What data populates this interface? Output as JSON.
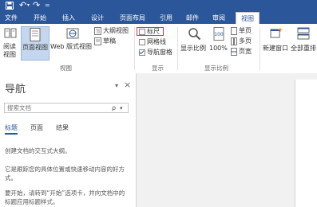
{
  "quick_access": {
    "save_icon": "save-icon",
    "undo_icon": "undo-icon",
    "undo_arrow": "↶",
    "redo_icon": "redo-icon",
    "redo_glyph": "↷",
    "customize_glyph": "="
  },
  "tabs": [
    {
      "label": "文件",
      "active": false
    },
    {
      "label": "开始",
      "active": false
    },
    {
      "label": "插入",
      "active": false
    },
    {
      "label": "设计",
      "active": false
    },
    {
      "label": "页面布局",
      "active": false
    },
    {
      "label": "引用",
      "active": false
    },
    {
      "label": "邮件",
      "active": false
    },
    {
      "label": "审阅",
      "active": false
    },
    {
      "label": "视图",
      "active": true
    }
  ],
  "ribbon": {
    "views": {
      "group_label": "视图",
      "read_mode": "阅读",
      "read_mode_2": "视图",
      "print_layout": "页面视图",
      "web_layout": "Web 版式视图",
      "outline": "大纲视图",
      "draft": "草稿"
    },
    "show": {
      "group_label": "显示",
      "ruler": "标尺",
      "ruler_checked": false,
      "gridlines": "网格线",
      "gridlines_checked": false,
      "nav_pane": "导航窗格",
      "nav_pane_checked": true
    },
    "zoom": {
      "group_label": "显示比例",
      "zoom": "显示比例",
      "percent": "100%",
      "one_page": "单页",
      "multi_page": "多页",
      "page_width": "页宽"
    },
    "window": {
      "new_window": "新建窗口",
      "arrange_all": "全部重排"
    }
  },
  "nav_pane": {
    "title": "导航",
    "pin_glyph": "▾",
    "close_glyph": "×",
    "search_placeholder": "搜索文档",
    "search_glyph": "ρ",
    "dropdown_glyph": "▾",
    "tabs": [
      {
        "label": "标题",
        "active": true
      },
      {
        "label": "页面",
        "active": false
      },
      {
        "label": "结果",
        "active": false
      }
    ],
    "paragraphs": [
      "创建文档的交互式大纲。",
      "它是跟踪您的具体位置或快速移动内容的好方",
      "式。",
      "要开始，请转到“开始”选项卡，并向文档中的",
      "标题应用标题样式。"
    ]
  },
  "colors": {
    "accent": "#2b579a",
    "ruler_highlight": "#e8312f"
  }
}
